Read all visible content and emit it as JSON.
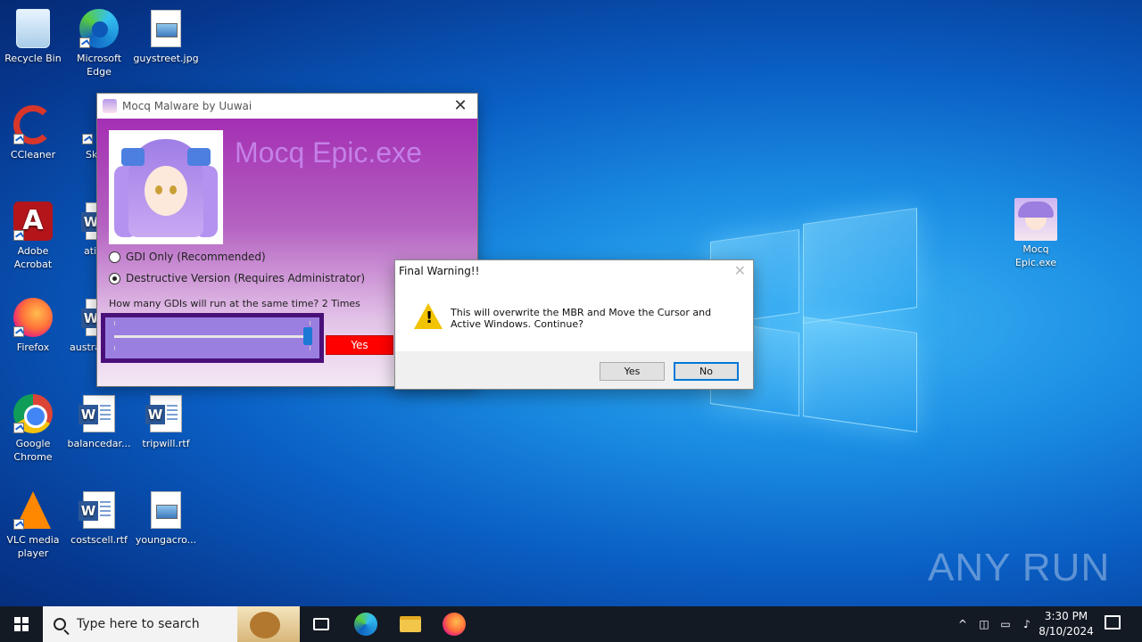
{
  "desktop": {
    "icons": [
      {
        "label": "Recycle Bin",
        "icon": "recycle-bin-icon"
      },
      {
        "label": "Microsoft Edge",
        "icon": "edge-icon"
      },
      {
        "label": "guystreet.jpg",
        "icon": "image-file-icon"
      },
      {
        "label": "CCleaner",
        "icon": "ccleaner-icon"
      },
      {
        "label": "Sk",
        "icon": "skype-icon"
      },
      {
        "label": "Adobe Acrobat",
        "icon": "acrobat-icon"
      },
      {
        "label": "ati",
        "icon": "word-doc-icon"
      },
      {
        "label": "Firefox",
        "icon": "firefox-icon"
      },
      {
        "label": "austra",
        "icon": "word-doc-icon"
      },
      {
        "label": "Google Chrome",
        "icon": "chrome-icon"
      },
      {
        "label": "balancedar...",
        "icon": "word-doc-icon"
      },
      {
        "label": "tripwill.rtf",
        "icon": "word-doc-icon"
      },
      {
        "label": "VLC media player",
        "icon": "vlc-icon"
      },
      {
        "label": "costscell.rtf",
        "icon": "word-doc-icon"
      },
      {
        "label": "youngacro...",
        "icon": "image-file-icon"
      },
      {
        "label": "Mocq Epic.exe",
        "icon": "anime-exe-icon"
      }
    ]
  },
  "mocq_window": {
    "title": "Mocq Malware by Uuwai",
    "heading": "Mocq Epic.exe",
    "option_gdi": "GDI Only (Recommended)",
    "option_destructive": "Destructive Version (Requires Administrator)",
    "selected_option": "destructive",
    "slider_label": "How many GDIs will run at the same time? 2 Times",
    "slider_level": 1.0,
    "yes_label": "Yes"
  },
  "dialog": {
    "title": "Final Warning!!",
    "message": "This will overwrite the MBR and Move the Cursor and Active Windows. Continue?",
    "yes_label": "Yes",
    "no_label": "No"
  },
  "watermark": "ANY RUN",
  "taskbar": {
    "search_placeholder": "Type here to search",
    "time": "3:30 PM",
    "date": "8/10/2024"
  },
  "colors": {
    "accent": "#0078d7",
    "mocq_title": "#c480e6",
    "yes_red": "#ff0000",
    "slider_frame": "#4a1079"
  }
}
